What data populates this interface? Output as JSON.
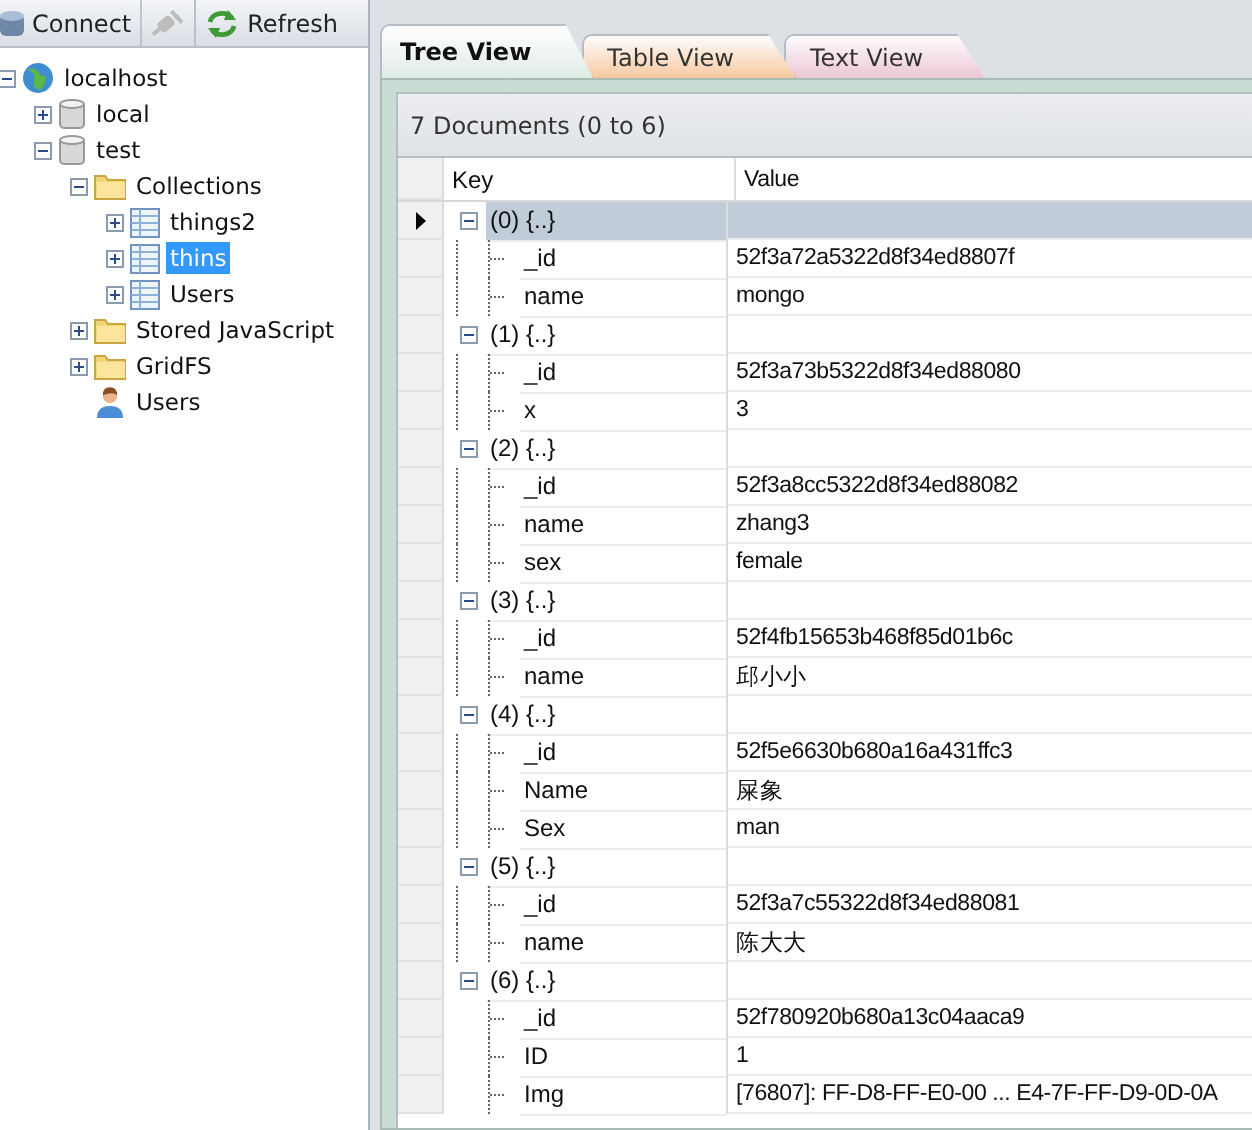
{
  "toolbar": [
    {
      "kind": "connect",
      "label": "Connect",
      "disabled": false
    },
    {
      "kind": "disconnect",
      "disabled": true
    },
    {
      "kind": "refresh",
      "label": "Refresh",
      "disabled": false
    }
  ],
  "tree": [
    {
      "kind": "server",
      "label": "localhost",
      "expanded": true,
      "selected": false,
      "children": [
        {
          "kind": "database",
          "label": "local",
          "expanded": false,
          "selected": false
        },
        {
          "kind": "database",
          "label": "test",
          "expanded": true,
          "selected": false,
          "children": [
            {
              "kind": "folder",
              "label": "Collections",
              "expanded": true,
              "selected": false,
              "children": [
                {
                  "kind": "collection",
                  "label": "things2",
                  "expanded": false,
                  "selected": false
                },
                {
                  "kind": "collection",
                  "label": "thins",
                  "expanded": false,
                  "selected": true
                },
                {
                  "kind": "collection",
                  "label": "Users",
                  "expanded": false,
                  "selected": false
                }
              ]
            },
            {
              "kind": "folder",
              "label": "Stored JavaScript",
              "expanded": false,
              "selected": false
            },
            {
              "kind": "folder",
              "label": "GridFS",
              "expanded": false,
              "selected": false
            },
            {
              "kind": "user",
              "label": "Users",
              "selected": false
            }
          ]
        }
      ]
    }
  ],
  "tabs": [
    {
      "label": "Tree View",
      "selected": true,
      "color": "#dfece6"
    },
    {
      "label": "Table View",
      "selected": false,
      "color": "#f8c9a0"
    },
    {
      "label": "Text View",
      "selected": false,
      "color": "#ecc6d6"
    }
  ],
  "summary": "7 Documents (0 to 6)",
  "columns": [
    "Key",
    "Value"
  ],
  "documents": [
    {
      "key": "(0) {..}",
      "selected": true,
      "expanded": true,
      "fields": [
        {
          "key": "_id",
          "value": "52f3a72a5322d8f34ed8807f"
        },
        {
          "key": "name",
          "value": "mongo"
        }
      ]
    },
    {
      "key": "(1) {..}",
      "selected": false,
      "expanded": true,
      "fields": [
        {
          "key": "_id",
          "value": "52f3a73b5322d8f34ed88080"
        },
        {
          "key": "x",
          "value": "3"
        }
      ]
    },
    {
      "key": "(2) {..}",
      "selected": false,
      "expanded": true,
      "fields": [
        {
          "key": "_id",
          "value": "52f3a8cc5322d8f34ed88082"
        },
        {
          "key": "name",
          "value": "zhang3"
        },
        {
          "key": "sex",
          "value": "female"
        }
      ]
    },
    {
      "key": "(3) {..}",
      "selected": false,
      "expanded": true,
      "fields": [
        {
          "key": "_id",
          "value": "52f4fb15653b468f85d01b6c"
        },
        {
          "key": "name",
          "value": "邱小小"
        }
      ]
    },
    {
      "key": "(4) {..}",
      "selected": false,
      "expanded": true,
      "fields": [
        {
          "key": "_id",
          "value": "52f5e6630b680a16a431ffc3"
        },
        {
          "key": "Name",
          "value": "屎象"
        },
        {
          "key": "Sex",
          "value": "man"
        }
      ]
    },
    {
      "key": "(5) {..}",
      "selected": false,
      "expanded": true,
      "fields": [
        {
          "key": "_id",
          "value": "52f3a7c55322d8f34ed88081"
        },
        {
          "key": "name",
          "value": "陈大大"
        }
      ]
    },
    {
      "key": "(6) {..}",
      "selected": false,
      "expanded": true,
      "fields": [
        {
          "key": "_id",
          "value": "52f780920b680a13c04aaca9"
        },
        {
          "key": "ID",
          "value": "1"
        },
        {
          "key": "Img",
          "value": "[76807]: FF-D8-FF-E0-00 ... E4-7F-FF-D9-0D-0A"
        }
      ]
    }
  ]
}
